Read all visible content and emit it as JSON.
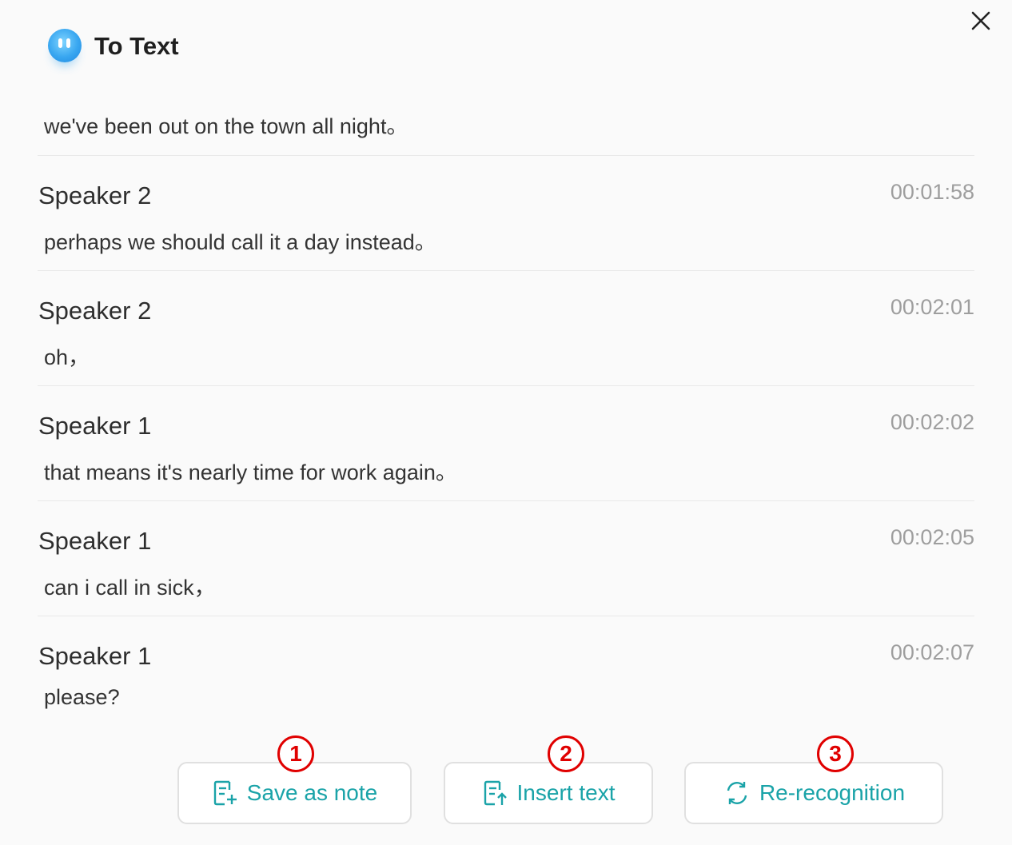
{
  "window": {
    "title": "To Text"
  },
  "transcript": {
    "first_text": "we've been out on the town all night。",
    "entries": [
      {
        "speaker": "Speaker 2",
        "time": "00:01:58",
        "text": "perhaps we should call it a day instead。"
      },
      {
        "speaker": "Speaker 2",
        "time": "00:02:01",
        "text": "oh，"
      },
      {
        "speaker": "Speaker 1",
        "time": "00:02:02",
        "text": "that means it's nearly time for work again。"
      },
      {
        "speaker": "Speaker 1",
        "time": "00:02:05",
        "text": "can i call in sick，"
      },
      {
        "speaker": "Speaker 1",
        "time": "00:02:07",
        "text": "please?"
      }
    ]
  },
  "actions": {
    "save_label": "Save as note",
    "insert_label": "Insert text",
    "rerecognize_label": "Re-recognition"
  },
  "markers": [
    "1",
    "2",
    "3"
  ],
  "colors": {
    "accent": "#1aa3a8",
    "marker": "#e00000",
    "logo": "#38a6f0"
  }
}
